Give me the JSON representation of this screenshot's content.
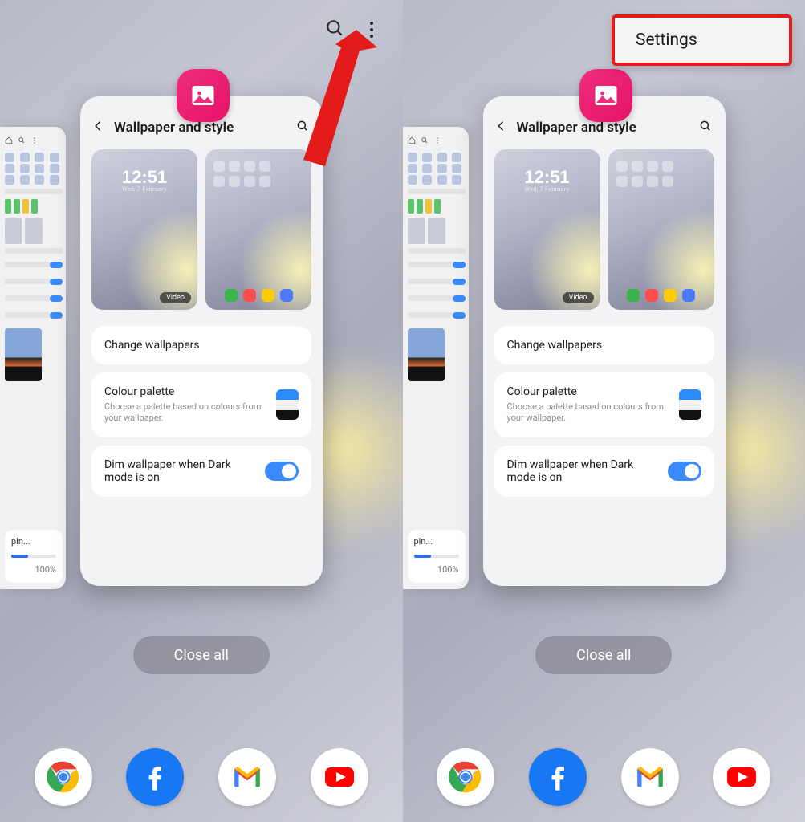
{
  "shared": {
    "card_title": "Wallpaper and style",
    "lock_clock": "12:51",
    "lock_date": "Wed, 7 February",
    "video_tag": "Video",
    "change_wallpapers": "Change wallpapers",
    "colour_palette_title": "Colour palette",
    "colour_palette_desc": "Choose a palette based on colours from your wallpaper.",
    "dim_label": "Dim wallpaper when Dark mode is on",
    "close_all": "Close all",
    "palette_colors": [
      "#2a8cff",
      "#f2f2f2",
      "#111111"
    ],
    "sliver_caption": "pin...",
    "sliver_pct": "100%",
    "dock_apps": [
      "chrome",
      "facebook",
      "gmail",
      "youtube"
    ]
  },
  "right": {
    "popup_label": "Settings"
  }
}
